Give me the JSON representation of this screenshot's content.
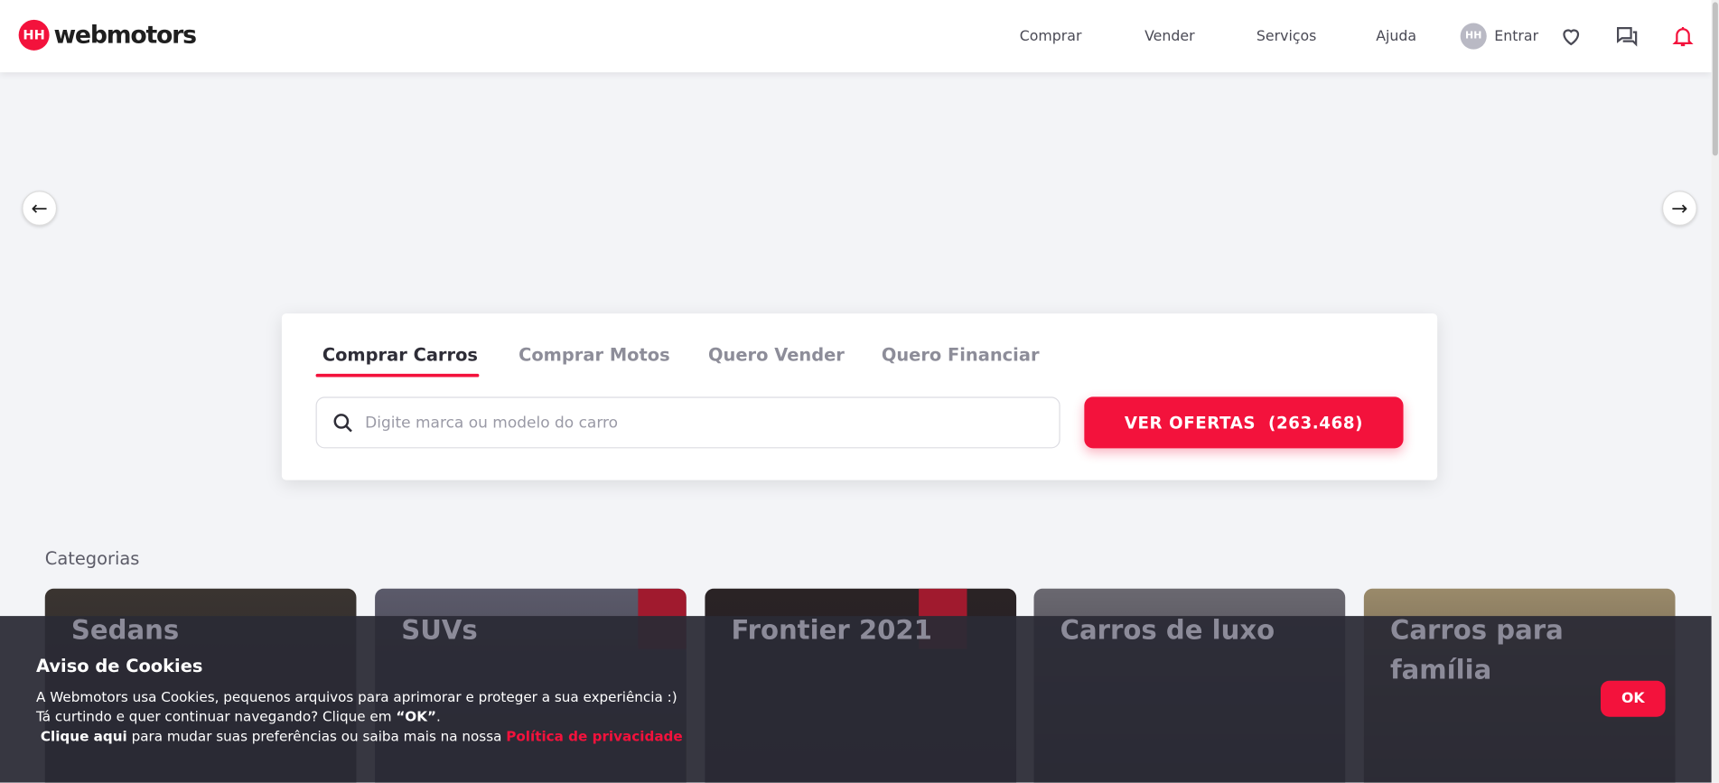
{
  "header": {
    "logo_text": "webmotors",
    "logo_mark": "HH",
    "nav": [
      "Comprar",
      "Vender",
      "Serviços",
      "Ajuda"
    ],
    "login": "Entrar",
    "avatar": "HH"
  },
  "search": {
    "tabs": [
      "Comprar Carros",
      "Comprar Motos",
      "Quero Vender",
      "Quero Financiar"
    ],
    "placeholder": "Digite marca ou modelo do carro",
    "button": "VER OFERTAS  (263.468)"
  },
  "categories": {
    "title": "Categorias",
    "items": [
      "Sedans",
      "SUVs",
      "Frontier 2021",
      "Carros de luxo",
      "Carros para família"
    ]
  },
  "cookies": {
    "title": "Aviso de Cookies",
    "line1": "A Webmotors usa Cookies, pequenos arquivos para aprimorar e proteger a sua experiência :)",
    "line2_a": "Tá curtindo e quer continuar navegando? Clique em ",
    "line2_b": "“OK”",
    "line2_c": ".",
    "line3_a": "Clique aqui",
    "line3_b": " para mudar suas preferências ou saiba mais na nossa ",
    "line3_c": "Política de privacidade",
    "ok": "OK"
  },
  "colors": {
    "brand": "#f3123c"
  }
}
